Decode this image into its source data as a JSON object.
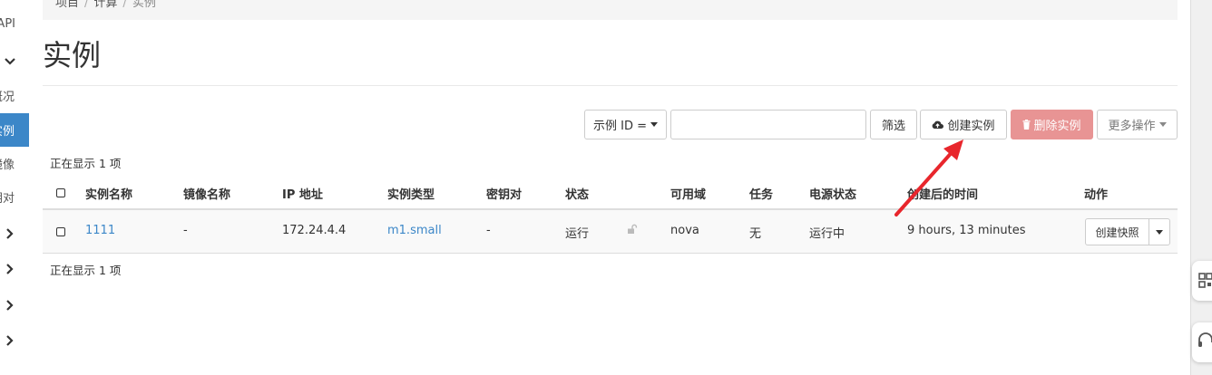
{
  "sidebar": {
    "items": [
      {
        "label": "API"
      },
      {
        "label": "概况"
      },
      {
        "label": "实例"
      },
      {
        "label": "镜像"
      },
      {
        "label": "密钥对"
      }
    ]
  },
  "breadcrumb": [
    "项目",
    "计算",
    "实例"
  ],
  "page_title": "实例",
  "toolbar": {
    "filter_select": "示例 ID =",
    "filter_input_value": "",
    "filter_button": "筛选",
    "create_button": "创建实例",
    "delete_button": "删除实例",
    "more_button": "更多操作"
  },
  "count_top": "正在显示 1 项",
  "count_bottom": "正在显示 1 项",
  "table": {
    "headers": [
      "实例名称",
      "镜像名称",
      "IP 地址",
      "实例类型",
      "密钥对",
      "状态",
      "可用域",
      "任务",
      "电源状态",
      "创建后的时间",
      "动作"
    ],
    "rows": [
      {
        "name": "1111",
        "image": "-",
        "ip": "172.24.4.4",
        "flavor": "m1.small",
        "keypair": "-",
        "status": "运行",
        "zone": "nova",
        "task": "无",
        "power": "运行中",
        "age": "9 hours, 13 minutes",
        "action": "创建快照"
      }
    ]
  },
  "colors": {
    "accent": "#3c87c8",
    "danger": "#e89494",
    "arrow": "#e8262c"
  }
}
